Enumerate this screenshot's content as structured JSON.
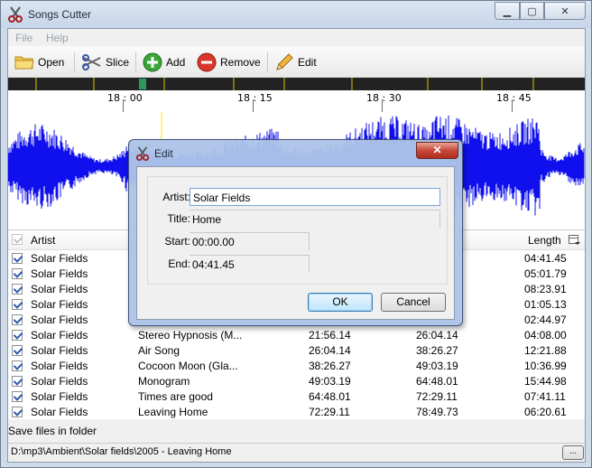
{
  "window": {
    "title": "Songs Cutter",
    "minimize": "▁",
    "maximize": "▢",
    "close": "✕"
  },
  "menu": {
    "items": [
      "File",
      "Help"
    ]
  },
  "toolbar": {
    "open": "Open",
    "slice": "Slice",
    "add": "Add",
    "remove": "Remove",
    "edit": "Edit"
  },
  "ruler": {
    "ticks": [
      "18 : 00",
      "18 : 15",
      "18 : 30",
      "18 : 45"
    ]
  },
  "colors": {
    "waveform": "#1010ee",
    "cursor": "#ffe600",
    "timeline": "#222222"
  },
  "list": {
    "headers": {
      "artist": "Artist",
      "length": "Length"
    },
    "rows": [
      {
        "artist": "Solar Fields",
        "title": "",
        "start": "",
        "end": "",
        "length": "04:41.45"
      },
      {
        "artist": "Solar Fields",
        "title": "",
        "start": "",
        "end": "",
        "length": "05:01.79"
      },
      {
        "artist": "Solar Fields",
        "title": "",
        "start": "",
        "end": "",
        "length": "08:23.91"
      },
      {
        "artist": "Solar Fields",
        "title": "",
        "start": "",
        "end": "",
        "length": "01:05.13"
      },
      {
        "artist": "Solar Fields",
        "title": "",
        "start": "",
        "end": "",
        "length": "02:44.97"
      },
      {
        "artist": "Solar Fields",
        "title": "Stereo Hypnosis (M...",
        "start": "21:56.14",
        "end": "26:04.14",
        "length": "04:08.00"
      },
      {
        "artist": "Solar Fields",
        "title": "Air Song",
        "start": "26:04.14",
        "end": "38:26.27",
        "length": "12:21.88"
      },
      {
        "artist": "Solar Fields",
        "title": "Cocoon Moon (Gla...",
        "start": "38:26.27",
        "end": "49:03.19",
        "length": "10:36.99"
      },
      {
        "artist": "Solar Fields",
        "title": "Monogram",
        "start": "49:03.19",
        "end": "64:48.01",
        "length": "15:44.98"
      },
      {
        "artist": "Solar Fields",
        "title": "Times are good",
        "start": "64:48.01",
        "end": "72:29.11",
        "length": "07:41.11"
      },
      {
        "artist": "Solar Fields",
        "title": "Leaving Home",
        "start": "72:29.11",
        "end": "78:49.73",
        "length": "06:20.61"
      }
    ]
  },
  "footer": {
    "save_label": "Save files in folder",
    "path": "D:\\mp3\\Ambient\\Solar fields\\2005 - Leaving Home",
    "browse": "..."
  },
  "dialog": {
    "title": "Edit",
    "close": "✕",
    "labels": {
      "artist": "Artist:",
      "title": "Title:",
      "start": "Start:",
      "end": "End:"
    },
    "values": {
      "artist": "Solar Fields",
      "title": "Home",
      "start": "00:00.00",
      "end": "04:41.45"
    },
    "ok": "OK",
    "cancel": "Cancel"
  }
}
